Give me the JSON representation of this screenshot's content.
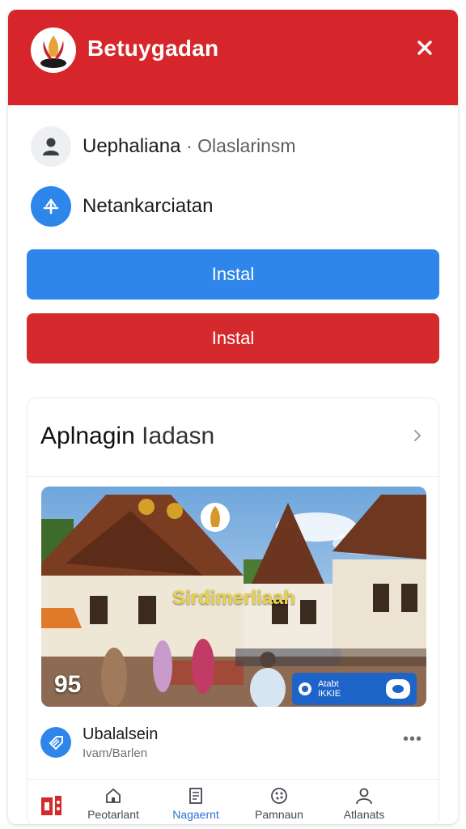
{
  "header": {
    "title": "Betuygadan",
    "logo_icon": "torch-emblem-icon",
    "close_icon": "close-icon"
  },
  "rows": [
    {
      "icon": "person-icon",
      "label": "Uephaliana",
      "sublabel": "· Olaslarinsm"
    },
    {
      "icon": "plus-icon",
      "label": "Netankarciatan"
    }
  ],
  "buttons": {
    "primary_label": "Instal",
    "secondary_label": "Instal"
  },
  "panel": {
    "title_bold": "Aplnagin",
    "title_light": "Iadasn",
    "hero": {
      "overlay_title": "Sirdimerliaah",
      "count": "95",
      "badge_line1": "Atabt",
      "badge_line2": "IKKIE"
    },
    "item": {
      "title": "Ubalalsein",
      "subtitle": "Ivam/Barlen",
      "more_icon": "more-horizontal-icon"
    }
  },
  "tabs": [
    {
      "icon": "home-icon",
      "label": "Peotarlant",
      "active": false
    },
    {
      "icon": "document-icon",
      "label": "Nagaernt",
      "active": true
    },
    {
      "icon": "palette-icon",
      "label": "Pamnaun",
      "active": false
    },
    {
      "icon": "person-icon",
      "label": "Atlanats",
      "active": false
    }
  ],
  "colors": {
    "brand_red": "#d7262b",
    "accent_blue": "#2f86ea",
    "active_tab": "#2f6fd6"
  }
}
